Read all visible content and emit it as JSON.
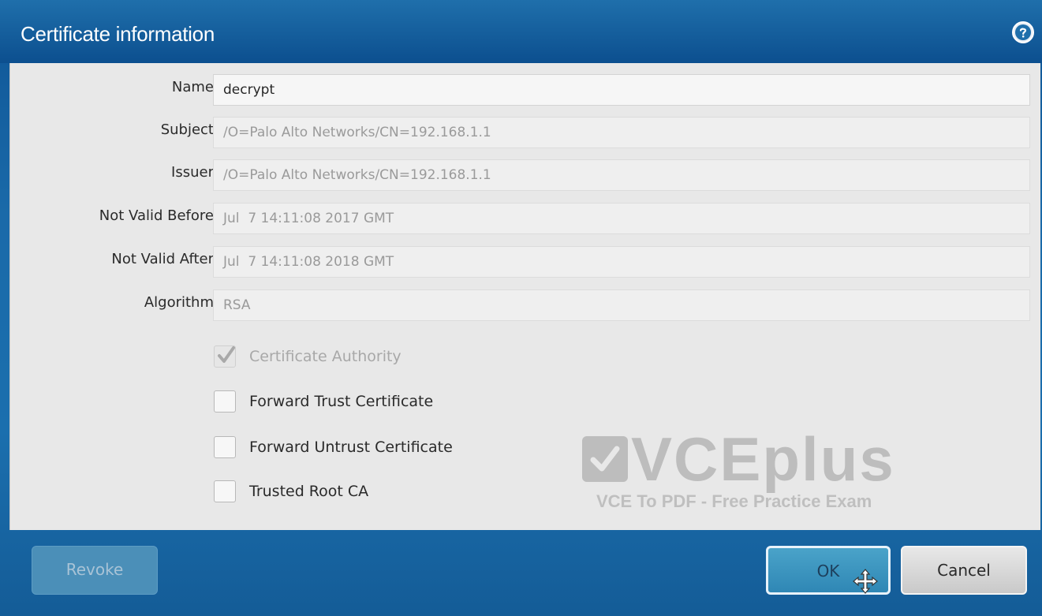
{
  "dialog": {
    "title": "Certificate information",
    "help_icon": "help-circle-icon"
  },
  "fields": [
    {
      "label": "Name",
      "value": "decrypt",
      "editable": true
    },
    {
      "label": "Subject",
      "value": "/O=Palo Alto Networks/CN=192.168.1.1",
      "editable": false
    },
    {
      "label": "Issuer",
      "value": "/O=Palo Alto Networks/CN=192.168.1.1",
      "editable": false
    },
    {
      "label": "Not Valid Before",
      "value": "Jul  7 14:11:08 2017 GMT",
      "editable": false
    },
    {
      "label": "Not Valid After",
      "value": "Jul  7 14:11:08 2018 GMT",
      "editable": false
    },
    {
      "label": "Algorithm",
      "value": "RSA",
      "editable": false
    }
  ],
  "checkboxes": [
    {
      "label": "Certificate Authority",
      "checked": true,
      "disabled": true
    },
    {
      "label": "Forward Trust Certificate",
      "checked": false,
      "disabled": false
    },
    {
      "label": "Forward Untrust Certificate",
      "checked": false,
      "disabled": false
    },
    {
      "label": "Trusted Root CA",
      "checked": false,
      "disabled": false
    }
  ],
  "watermark": {
    "brand": "VCEplus",
    "subtitle": "VCE To PDF - Free Practice Exam"
  },
  "buttons": {
    "revoke": "Revoke",
    "ok": "OK",
    "cancel": "Cancel"
  },
  "colors": {
    "titlebar": "#0c4f8f",
    "content_bg": "#e8e8e8",
    "ok_button": "#2f87b5"
  }
}
